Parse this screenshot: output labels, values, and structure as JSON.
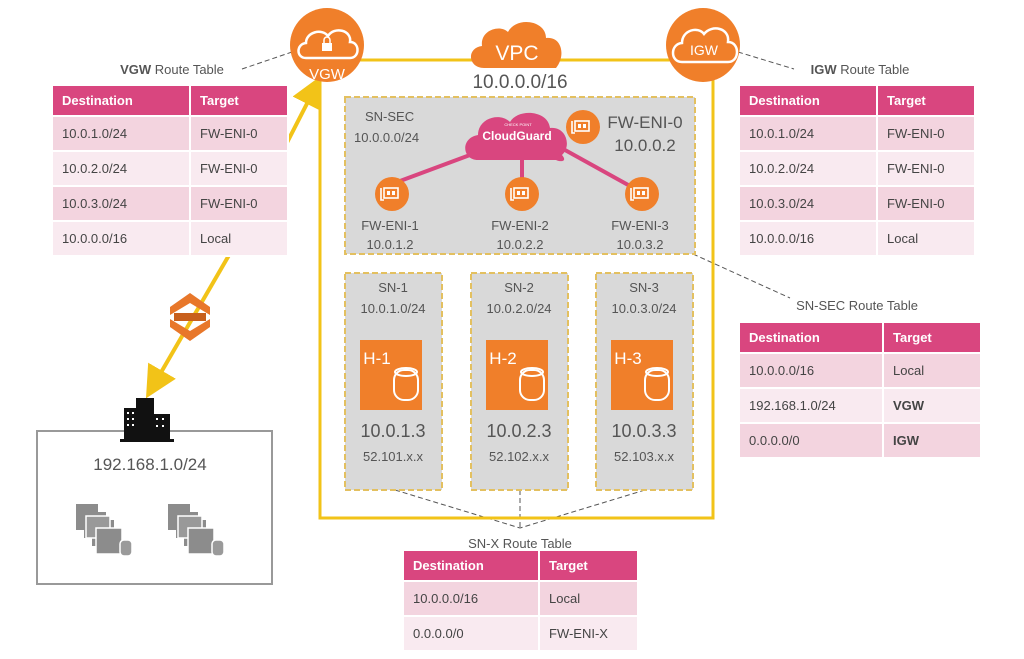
{
  "colors": {
    "accent_orange": "#f07f2a",
    "vpc_border": "#f2c318",
    "table_header": "#d9467f",
    "row_a": "#f3d4df",
    "row_b": "#f9eaf0",
    "cloudguard": "#d9467f"
  },
  "gateways": {
    "vgw": "VGW",
    "vpc": "VPC",
    "igw": "IGW"
  },
  "vpc_cidr": "10.0.0.0/16",
  "sn_sec": {
    "name": "SN-SEC",
    "cidr": "10.0.0.0/24",
    "cloudguard_brand": "CHECK POINT",
    "cloudguard": "CloudGuard",
    "eni0": {
      "name": "FW-ENI-0",
      "ip": "10.0.0.2"
    },
    "enis": [
      {
        "name": "FW-ENI-1",
        "ip": "10.0.1.2"
      },
      {
        "name": "FW-ENI-2",
        "ip": "10.0.2.2"
      },
      {
        "name": "FW-ENI-3",
        "ip": "10.0.3.2"
      }
    ]
  },
  "subnets": [
    {
      "name": "SN-1",
      "cidr": "10.0.1.0/24",
      "host": "H-1",
      "ip": "10.0.1.3",
      "public_ip": "52.101.x.x"
    },
    {
      "name": "SN-2",
      "cidr": "10.0.2.0/24",
      "host": "H-2",
      "ip": "10.0.2.3",
      "public_ip": "52.102.x.x"
    },
    {
      "name": "SN-3",
      "cidr": "10.0.3.0/24",
      "host": "H-3",
      "ip": "10.0.3.3",
      "public_ip": "52.103.x.x"
    }
  ],
  "onprem": {
    "cidr": "192.168.1.0/24"
  },
  "icons": {
    "vgw": "cloud-lock-icon",
    "igw": "cloud-icon",
    "eni": "network-card-icon",
    "host": "server-database-icon",
    "building": "office-building-icon",
    "vpn": "vpn-gateway-icon",
    "servers": "server-stack-icon"
  },
  "tables": {
    "vgw": {
      "title_bold": "VGW",
      "title_rest": " Route Table",
      "headers": [
        "Destination",
        "Target"
      ],
      "rows": [
        [
          "10.0.1.0/24",
          "FW-ENI-0"
        ],
        [
          "10.0.2.0/24",
          "FW-ENI-0"
        ],
        [
          "10.0.3.0/24",
          "FW-ENI-0"
        ],
        [
          "10.0.0.0/16",
          "Local"
        ]
      ]
    },
    "igw": {
      "title_bold": "IGW",
      "title_rest": " Route Table",
      "headers": [
        "Destination",
        "Target"
      ],
      "rows": [
        [
          "10.0.1.0/24",
          "FW-ENI-0"
        ],
        [
          "10.0.2.0/24",
          "FW-ENI-0"
        ],
        [
          "10.0.3.0/24",
          "FW-ENI-0"
        ],
        [
          "10.0.0.0/16",
          "Local"
        ]
      ]
    },
    "snsec": {
      "title": "SN-SEC Route Table",
      "headers": [
        "Destination",
        "Target"
      ],
      "rows": [
        [
          "10.0.0.0/16",
          "Local"
        ],
        [
          "192.168.1.0/24",
          "VGW"
        ],
        [
          "0.0.0.0/0",
          "IGW"
        ]
      ]
    },
    "snx": {
      "title": "SN-X Route Table",
      "headers": [
        "Destination",
        "Target"
      ],
      "rows": [
        [
          "10.0.0.0/16",
          "Local"
        ],
        [
          "0.0.0.0/0",
          "FW-ENI-X"
        ]
      ]
    }
  }
}
